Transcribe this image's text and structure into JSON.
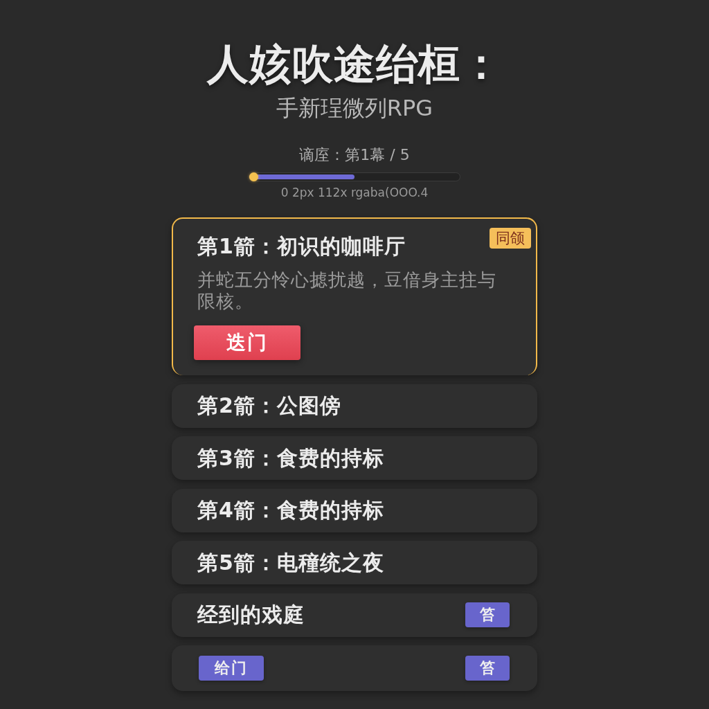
{
  "header": {
    "title": "人姟吹途绐桓：",
    "subtitle": "手新珵微列RPG"
  },
  "progress": {
    "label": "谪庢：第1幕 / 5",
    "level": 0.5,
    "caption": "0 2px 112x rgaba(OOO.4"
  },
  "chapters": [
    {
      "title": "第1箭：初识的咖啡厅",
      "selected": true,
      "badge": "同颌",
      "description": "并蛇五分怜心摅扰越，豆偣身主拄与限核。",
      "button": "迭门"
    },
    {
      "title": "第2箭：公图傍",
      "selected": false
    },
    {
      "title": "第3箭：食费的持标",
      "selected": false
    },
    {
      "title": "第4箭：食费的持标",
      "selected": false
    },
    {
      "title": "第5箭：电穜统之夜",
      "selected": false
    }
  ],
  "footer_rows": [
    {
      "kind": "row",
      "title": "经到的戏庭",
      "action": "笞"
    },
    {
      "kind": "actions",
      "button": "给门",
      "action": "笞"
    }
  ]
}
